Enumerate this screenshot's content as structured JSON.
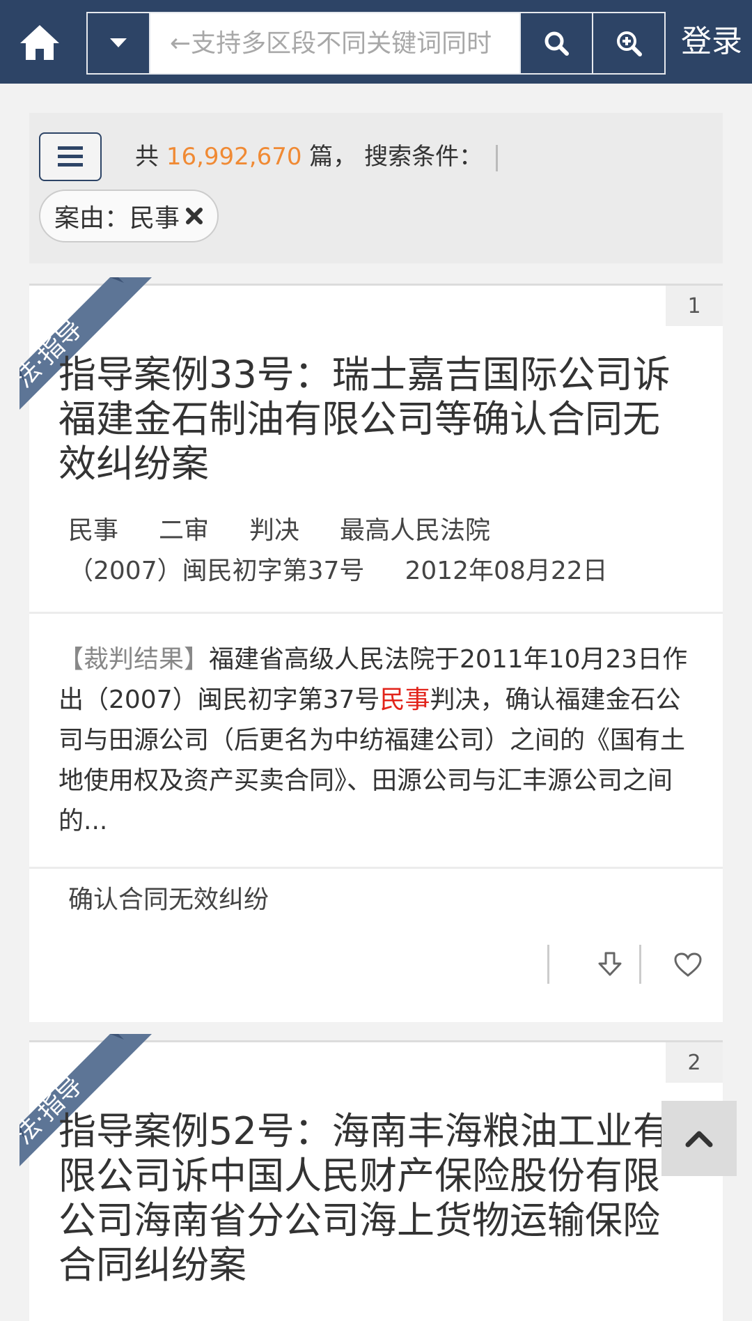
{
  "header": {
    "search_placeholder": "←支持多区段不同关键词同时",
    "login_label": "登录"
  },
  "filter": {
    "count_prefix": "共",
    "count_value": "16,992,670",
    "count_suffix": "篇， 搜索条件：",
    "tag_label": "案由：民事"
  },
  "cards": [
    {
      "ribbon": "法·指导",
      "number": "1",
      "title": "指导案例33号：瑞士嘉吉国际公司诉福建金石制油有限公司等确认合同无效纠纷案",
      "meta": {
        "type": "民事",
        "stage": "二审",
        "doc_kind": "判决",
        "court": "最高人民法院",
        "case_no": "（2007）闽民初字第37号",
        "date": "2012年08月22日"
      },
      "summary": {
        "label": "【裁判结果】",
        "text_before": "福建省高级人民法院于2011年10月23日作出（2007）闽民初字第37号",
        "highlight": "民事",
        "text_after": "判决，确认福建金石公司与田源公司（后更名为中纺福建公司）之间的《国有土地使用权及资产买卖合同》、田源公司与汇丰源公司之间的..."
      },
      "topic": "确认合同无效纠纷"
    },
    {
      "ribbon": "法·指导",
      "number": "2",
      "title": "指导案例52号：海南丰海粮油工业有限公司诉中国人民财产保险股份有限公司海南省分公司海上货物运输保险合同纠纷案"
    }
  ],
  "colors": {
    "header_bg": "#2d4466",
    "count_highlight": "#f08a34",
    "keyword_highlight": "#e2231a",
    "ribbon_bg": "#5d7596"
  },
  "icons": [
    "home-icon",
    "caret-down-icon",
    "search-icon",
    "zoom-in-icon",
    "menu-icon",
    "close-icon",
    "download-icon",
    "heart-icon",
    "chevron-up-icon"
  ]
}
